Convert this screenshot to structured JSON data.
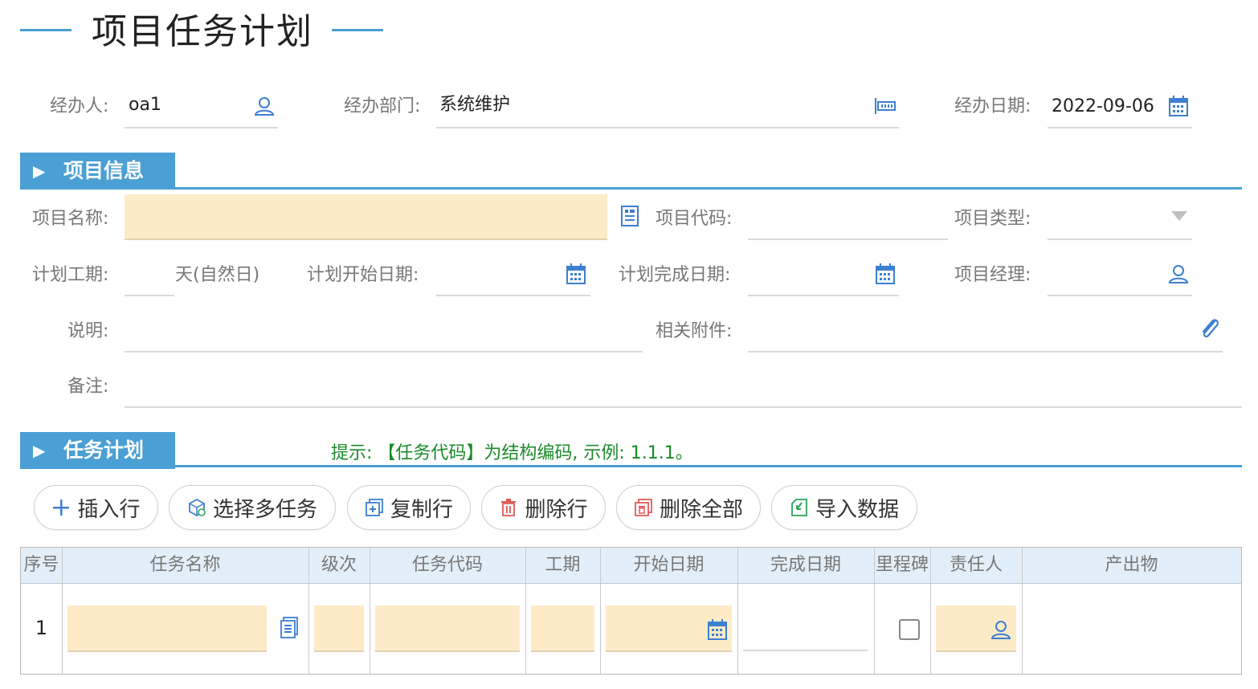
{
  "page": {
    "title": "项目任务计划"
  },
  "header_fields": {
    "handler_label": "经办人:",
    "handler_value": "oa1",
    "dept_label": "经办部门:",
    "dept_value": "系统维护",
    "date_label": "经办日期:",
    "date_value": "2022-09-06"
  },
  "project_info": {
    "section_title": "项目信息",
    "name_label": "项目名称:",
    "code_label": "项目代码:",
    "type_label": "项目类型:",
    "duration_label": "计划工期:",
    "duration_unit": "天(自然日)",
    "start_label": "计划开始日期:",
    "end_label": "计划完成日期:",
    "manager_label": "项目经理:",
    "desc_label": "说明:",
    "attach_label": "相关附件:",
    "remark_label": "备注:"
  },
  "task_plan": {
    "section_title": "任务计划",
    "hint": "提示: 【任务代码】为结构编码, 示例: 1.1.1。",
    "buttons": {
      "insert": "插入行",
      "select_multi": "选择多任务",
      "copy": "复制行",
      "delete_row": "删除行",
      "delete_all": "删除全部",
      "import": "导入数据"
    },
    "columns": [
      "序号",
      "任务名称",
      "级次",
      "任务代码",
      "工期",
      "开始日期",
      "完成日期",
      "里程碑",
      "责任人",
      "产出物"
    ],
    "rows": [
      {
        "index": "1",
        "milestone": false
      }
    ]
  },
  "colors": {
    "accent": "#4a9fd4",
    "highlight": "#fdebc8",
    "hint": "#1a8a2a"
  },
  "icons": [
    "user-icon",
    "org-tree-icon",
    "calendar-icon",
    "form-icon",
    "dropdown-arrow-icon",
    "paperclip-icon",
    "plus-icon",
    "cube-icon",
    "copy-icon",
    "trash-icon",
    "delete-all-icon",
    "import-icon"
  ]
}
